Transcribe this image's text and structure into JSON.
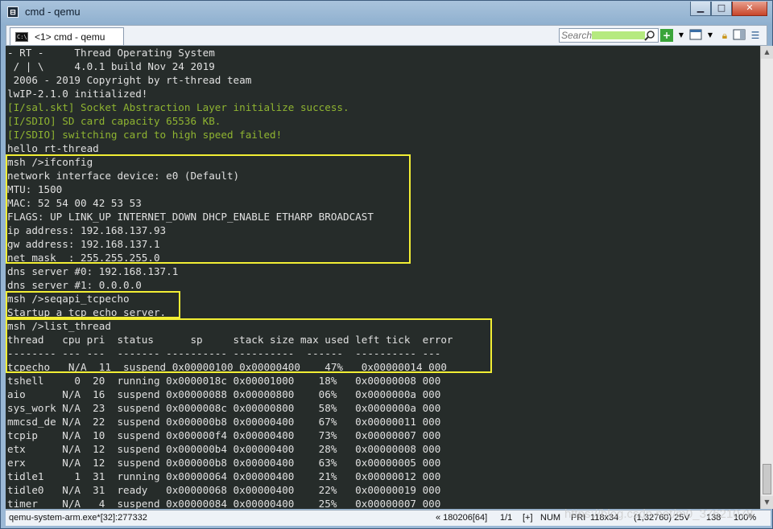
{
  "window": {
    "title": "cmd - qemu",
    "icon": "console-app-icon"
  },
  "controls": {
    "minimize": "▁",
    "maximize": "□",
    "close": "✕"
  },
  "toolbar": {
    "tab_label": "<1> cmd - qemu",
    "search_placeholder": "Search"
  },
  "console": {
    "lines": [
      {
        "text": "- RT -     Thread Operating System",
        "color": "#e0e0e0"
      },
      {
        "text": " / | \\     4.0.1 build Nov 24 2019",
        "color": "#e0e0e0"
      },
      {
        "text": " 2006 - 2019 Copyright by rt-thread team",
        "color": "#e0e0e0"
      },
      {
        "text": "lwIP-2.1.0 initialized!",
        "color": "#e0e0e0"
      },
      {
        "text": "[I/sal.skt] Socket Abstraction Layer initialize success.",
        "color": "#8fb431"
      },
      {
        "text": "[I/SDIO] SD card capacity 65536 KB.",
        "color": "#8fb431"
      },
      {
        "text": "[I/SDIO] switching card to high speed failed!",
        "color": "#8fb431"
      },
      {
        "text": "hello rt-thread",
        "color": "#e0e0e0"
      },
      {
        "text": "msh />ifconfig",
        "color": "#e0e0e0"
      },
      {
        "text": "network interface device: e0 (Default)",
        "color": "#e0e0e0"
      },
      {
        "text": "MTU: 1500",
        "color": "#e0e0e0"
      },
      {
        "text": "MAC: 52 54 00 42 53 53",
        "color": "#e0e0e0"
      },
      {
        "text": "FLAGS: UP LINK_UP INTERNET_DOWN DHCP_ENABLE ETHARP BROADCAST",
        "color": "#e0e0e0"
      },
      {
        "text": "ip address: 192.168.137.93",
        "color": "#e0e0e0"
      },
      {
        "text": "gw address: 192.168.137.1",
        "color": "#e0e0e0"
      },
      {
        "text": "net mask  : 255.255.255.0",
        "color": "#e0e0e0"
      },
      {
        "text": "dns server #0: 192.168.137.1",
        "color": "#e0e0e0"
      },
      {
        "text": "dns server #1: 0.0.0.0",
        "color": "#e0e0e0"
      },
      {
        "text": "msh />seqapi_tcpecho",
        "color": "#e0e0e0"
      },
      {
        "text": "Startup a tcp echo server.",
        "color": "#e0e0e0"
      },
      {
        "text": "msh />list_thread",
        "color": "#e0e0e0"
      },
      {
        "text": "thread   cpu pri  status      sp     stack size max used left tick  error",
        "color": "#e0e0e0"
      },
      {
        "text": "-------- --- ---  ------- ---------- ----------  ------  ---------- ---",
        "color": "#e0e0e0"
      },
      {
        "text": "tcpecho_  N/A  11  suspend 0x00000100 0x00000400    47%   0x00000014 000",
        "color": "#e0e0e0"
      },
      {
        "text": "tshell     0  20  running 0x0000018c 0x00001000    18%   0x00000008 000",
        "color": "#e0e0e0"
      },
      {
        "text": "aio      N/A  16  suspend 0x00000088 0x00000800    06%   0x0000000a 000",
        "color": "#e0e0e0"
      },
      {
        "text": "sys_work N/A  23  suspend 0x0000008c 0x00000800    58%   0x0000000a 000",
        "color": "#e0e0e0"
      },
      {
        "text": "mmcsd_de N/A  22  suspend 0x000000b8 0x00000400    67%   0x00000011 000",
        "color": "#e0e0e0"
      },
      {
        "text": "tcpip    N/A  10  suspend 0x000000f4 0x00000400    73%   0x00000007 000",
        "color": "#e0e0e0"
      },
      {
        "text": "etx      N/A  12  suspend 0x000000b4 0x00000400    28%   0x00000008 000",
        "color": "#e0e0e0"
      },
      {
        "text": "erx      N/A  12  suspend 0x000000b8 0x00000400    63%   0x00000005 000",
        "color": "#e0e0e0"
      },
      {
        "text": "tidle1     1  31  running 0x00000064 0x00000400    21%   0x00000012 000",
        "color": "#e0e0e0"
      },
      {
        "text": "tidle0   N/A  31  ready   0x00000068 0x00000400    22%   0x00000019 000",
        "color": "#e0e0e0"
      },
      {
        "text": "timer    N/A   4  suspend 0x00000084 0x00000400    25%   0x00000007 000",
        "color": "#e0e0e0"
      }
    ],
    "highlight_color": "#f2ee34"
  },
  "status": {
    "process": "qemu-system-arm.exe*[32]:277332",
    "position": "« 180206[64]",
    "page": "1/1",
    "plus": "[+]",
    "num": "NUM",
    "pri": "PRI",
    "size": "118x34",
    "cursor": "(1,32760) 25V",
    "pid": "138",
    "zoom": "100%"
  },
  "watermark": "https://blog.csdn.net/m0_37621078"
}
